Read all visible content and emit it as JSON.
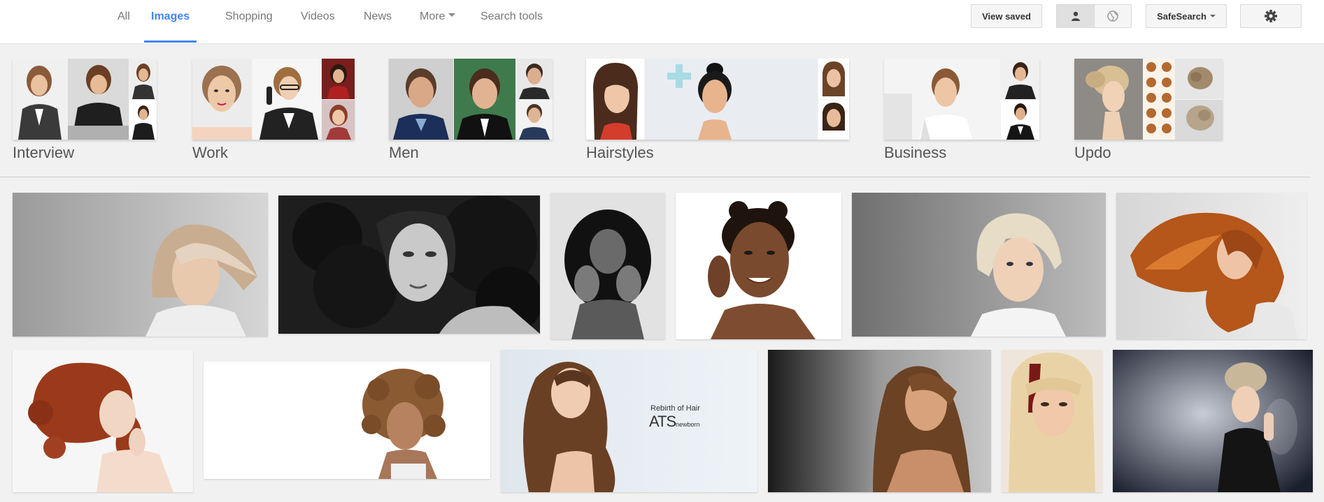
{
  "nav": {
    "tabs": [
      {
        "label": "All"
      },
      {
        "label": "Images",
        "active": true
      },
      {
        "label": "Shopping"
      },
      {
        "label": "Videos"
      },
      {
        "label": "News"
      },
      {
        "label": "More"
      },
      {
        "label": "Search tools"
      }
    ],
    "view_saved": "View saved",
    "safesearch": "SafeSearch",
    "accent_color": "#4285f4"
  },
  "related": [
    {
      "label": "Interview"
    },
    {
      "label": "Work"
    },
    {
      "label": "Men"
    },
    {
      "label": "Hairstyles"
    },
    {
      "label": "Business"
    },
    {
      "label": "Updo"
    }
  ],
  "ad_text": {
    "line1": "Rebirth of Hair",
    "brand": "ATS",
    "sub": "newborn"
  }
}
